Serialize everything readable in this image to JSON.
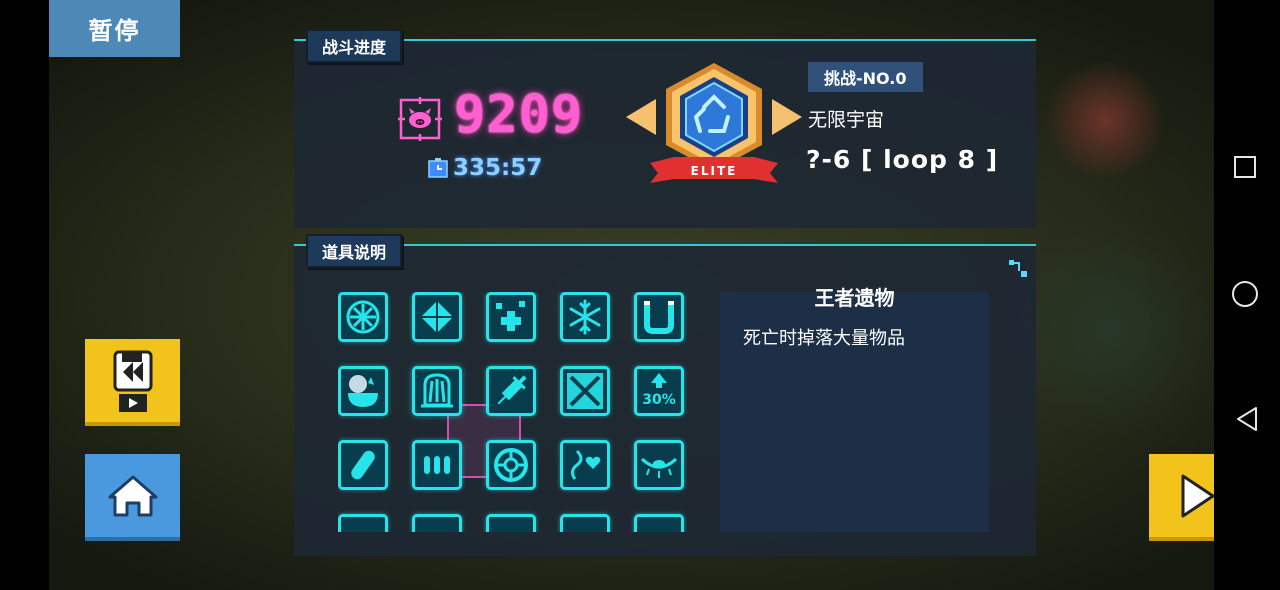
{
  "pause": {
    "label": "暂停"
  },
  "battle": {
    "tab_label": "战斗进度",
    "score": "9209",
    "time": "335:57",
    "challenge": "挑战-NO.0",
    "stage_name": "无限宇宙",
    "stage_loop": "?-6 [ loop 8 ]",
    "badge_banner": "ELITE"
  },
  "items": {
    "tab_label": "道具说明",
    "selected_name": "王者遗物",
    "selected_desc": "死亡时掉落大量物品",
    "grid": [
      {
        "row": 0,
        "col": 0,
        "icon": "fan-wheel-icon"
      },
      {
        "row": 0,
        "col": 1,
        "icon": "diamond-icon"
      },
      {
        "row": 0,
        "col": 2,
        "icon": "sparkle-plus-icon"
      },
      {
        "row": 0,
        "col": 3,
        "icon": "snowflake-icon"
      },
      {
        "row": 0,
        "col": 4,
        "icon": "magnet-icon"
      },
      {
        "row": 1,
        "col": 0,
        "icon": "cauldron-icon"
      },
      {
        "row": 1,
        "col": 1,
        "icon": "relic-tombstone-icon",
        "selected": true
      },
      {
        "row": 1,
        "col": 2,
        "icon": "syringe-icon"
      },
      {
        "row": 1,
        "col": 3,
        "icon": "crossed-swords-icon"
      },
      {
        "row": 1,
        "col": 4,
        "icon": "percent-boost-icon",
        "text": "30%"
      },
      {
        "row": 2,
        "col": 0,
        "icon": "pill-icon"
      },
      {
        "row": 2,
        "col": 1,
        "icon": "ammo-icon"
      },
      {
        "row": 2,
        "col": 2,
        "icon": "lifebuoy-icon"
      },
      {
        "row": 2,
        "col": 3,
        "icon": "heart-snake-icon"
      },
      {
        "row": 2,
        "col": 4,
        "icon": "eye-icon"
      },
      {
        "row": 3,
        "col": 0,
        "icon": "partial-icon"
      },
      {
        "row": 3,
        "col": 1,
        "icon": "partial-icon"
      },
      {
        "row": 3,
        "col": 2,
        "icon": "partial-icon"
      },
      {
        "row": 3,
        "col": 3,
        "icon": "partial-icon"
      },
      {
        "row": 3,
        "col": 4,
        "icon": "partial-icon"
      }
    ]
  },
  "colors": {
    "neon_cyan": "#25e5ea",
    "score_pink": "#ff5fd0",
    "button_yellow": "#f2c31b",
    "button_blue": "#4a98dd"
  }
}
